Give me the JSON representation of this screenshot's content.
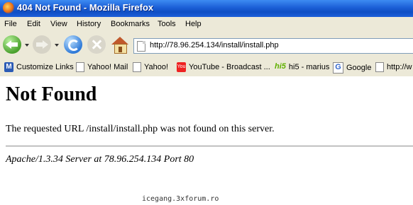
{
  "window": {
    "title": "404 Not Found - Mozilla Firefox"
  },
  "menu": [
    "File",
    "Edit",
    "View",
    "History",
    "Bookmarks",
    "Tools",
    "Help"
  ],
  "navigation": {
    "url": "http://78.96.254.134/install/install.php"
  },
  "bookmarks": [
    {
      "label": "Customize Links",
      "icon": "customize-links-icon"
    },
    {
      "label": "Yahoo! Mail",
      "icon": "page-icon"
    },
    {
      "label": "Yahoo!",
      "icon": "page-icon"
    },
    {
      "label": "YouTube - Broadcast ...",
      "icon": "youtube-icon"
    },
    {
      "label": "hi5 - marius",
      "icon": "hi5-icon"
    },
    {
      "label": "Google",
      "icon": "google-icon"
    },
    {
      "label": "http://w",
      "icon": "page-icon"
    }
  ],
  "icon_glyphs": {
    "youtube": "You",
    "hi5": "hi5",
    "google": "G",
    "customize": "M"
  },
  "page": {
    "heading": "Not Found",
    "message": "The requested URL /install/install.php was not found on this server.",
    "server_signature": "Apache/1.3.34 Server at 78.96.254.134 Port 80"
  },
  "watermark": "icegang.3xforum.ro",
  "colors": {
    "titlebar": "#1b5fd6",
    "chrome": "#ece9d8"
  }
}
